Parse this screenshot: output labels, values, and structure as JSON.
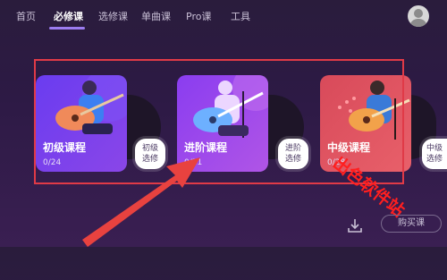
{
  "nav": {
    "tabs": [
      {
        "label": "首页"
      },
      {
        "label": "必修课"
      },
      {
        "label": "选修课"
      },
      {
        "label": "单曲课"
      },
      {
        "label": "Pro课"
      },
      {
        "label": "工具"
      }
    ],
    "active_tab": "必修课"
  },
  "cards": [
    {
      "title": "初级课程",
      "progress": "0/24",
      "tag_line1": "初级",
      "tag_line2": "选修"
    },
    {
      "title": "进阶课程",
      "progress": "0/21",
      "tag_line1": "进阶",
      "tag_line2": "选修"
    },
    {
      "title": "中级课程",
      "progress": "0/28",
      "tag_line1": "中级",
      "tag_line2": "选修"
    }
  ],
  "watermark": "出色软件站",
  "footer": {
    "buy_label": "购买课"
  },
  "colors": {
    "accent": "#9c7cf0",
    "highlight": "#e03a47",
    "annotation_arrow": "#e8423f"
  }
}
